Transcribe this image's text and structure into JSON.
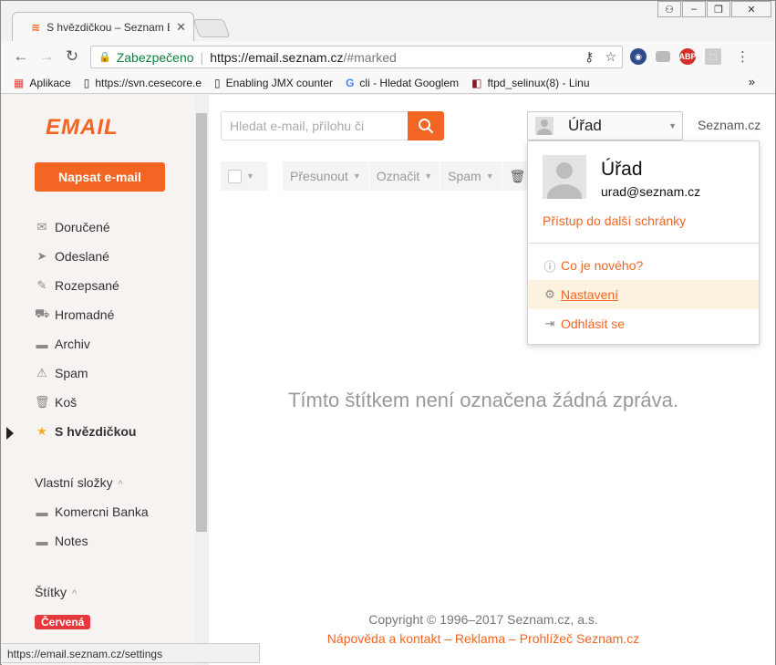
{
  "browser": {
    "tab_title": "S hvězdičkou – Seznam E",
    "tab_favicon": "≋",
    "tab_close": "✕",
    "address": {
      "secure_label": "Zabezpečeno",
      "url_scheme_host": "https://email.seznam.cz",
      "url_path": "/#marked"
    },
    "bookmarks": [
      {
        "icon": "apps-grid-icon",
        "glyph": "▦",
        "label": "Aplikace"
      },
      {
        "icon": "page-icon",
        "glyph": "▯",
        "label": "https://svn.cesecore.e"
      },
      {
        "icon": "page-icon",
        "glyph": "▯",
        "label": "Enabling JMX counter"
      },
      {
        "icon": "google-icon",
        "glyph": "G",
        "label": "cli - Hledat Googlem"
      },
      {
        "icon": "doc-icon",
        "glyph": "◧",
        "label": "ftpd_selinux(8) - Linu"
      }
    ],
    "bookmarks_more": "»",
    "status_url": "https://email.seznam.cz/settings"
  },
  "sidebar": {
    "logo_text": "EMAIL",
    "compose_label": "Napsat e-mail",
    "folders": [
      {
        "name": "inbox",
        "icon": "envelope-icon",
        "glyph": "✉",
        "label": "Doručené"
      },
      {
        "name": "sent",
        "icon": "paper-plane-icon",
        "glyph": "➤",
        "label": "Odeslané"
      },
      {
        "name": "drafts",
        "icon": "edit-icon",
        "glyph": "✎",
        "label": "Rozepsané"
      },
      {
        "name": "bulk",
        "icon": "cart-icon",
        "glyph": "⛟",
        "label": "Hromadné"
      },
      {
        "name": "archive",
        "icon": "archive-icon",
        "glyph": "▬",
        "label": "Archiv"
      },
      {
        "name": "spam",
        "icon": "warning-icon",
        "glyph": "⚠",
        "label": "Spam"
      },
      {
        "name": "trash",
        "icon": "trash-icon",
        "glyph": "🗑",
        "label": "Koš"
      },
      {
        "name": "starred",
        "icon": "star-icon",
        "glyph": "★",
        "label": "S hvězdičkou"
      }
    ],
    "custom_folders_heading": "Vlastní složky",
    "custom_folders": [
      {
        "name": "komercni-banka",
        "icon": "folder-icon",
        "glyph": "▬",
        "label": "Komercni Banka"
      },
      {
        "name": "notes",
        "icon": "folder-icon",
        "glyph": "▬",
        "label": "Notes"
      }
    ],
    "labels_heading": "Štítky",
    "label_badge": "Červená",
    "chevron": "^"
  },
  "main": {
    "search_placeholder": "Hledat e-mail, přílohu či",
    "actions": {
      "move": "Přesunout",
      "mark": "Označit",
      "spam": "Spam"
    },
    "empty_message": "Tímto štítkem není označena žádná zpráva.",
    "footer": {
      "copyright": "Copyright © 1996–2017 Seznam.cz, a.s.",
      "links": "Nápověda a kontakt – Reklama – Prohlížeč Seznam.cz"
    }
  },
  "account": {
    "button_name": "Úřad",
    "seznam_link": "Seznam.cz",
    "dropdown": {
      "name": "Úřad",
      "email": "urad@seznam.cz",
      "access_other": "Přístup do další schránky",
      "whats_new": "Co je nového?",
      "settings": "Nastavení",
      "logout": "Odhlásit se"
    }
  },
  "colors": {
    "brand": "#f26522",
    "label_red": "#e5393e",
    "secure_green": "#0b8043",
    "highlight": "#fdf1df"
  }
}
